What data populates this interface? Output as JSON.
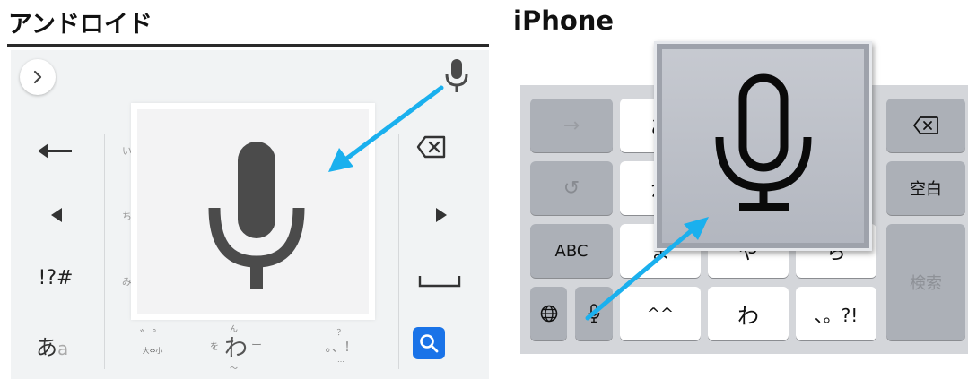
{
  "titles": {
    "android": "アンドロイド",
    "iphone": "iPhone"
  },
  "android": {
    "top_bar": {
      "expand_icon": "chevron-right-icon",
      "mic_icon": "mic-icon"
    },
    "left_keys": [
      {
        "name": "arrow-back-icon",
        "label": "←"
      },
      {
        "name": "cursor-left-icon",
        "label": "◀"
      },
      {
        "label": "!?#"
      },
      {
        "label": "あ",
        "sub": "a"
      }
    ],
    "faint_row_labels": [
      "い",
      "ち",
      "み"
    ],
    "bottom_keys": {
      "dakuten_label": "゛゜",
      "dakuten_sub": "大⇔小",
      "wa_main": "わ",
      "wa_left": "を",
      "wa_top": "ん",
      "wa_right": "ー",
      "wa_bottom": "〜",
      "punct_label": "。、！",
      "punct_top": "？",
      "punct_bottom": "…"
    },
    "right_keys": [
      {
        "name": "backspace-icon",
        "label": "⌫"
      },
      {
        "name": "cursor-right-icon",
        "label": "▶"
      },
      {
        "name": "space-icon",
        "label": "␣"
      },
      {
        "name": "search-icon",
        "label": "🔍"
      }
    ],
    "colors": {
      "search": "#1a73e8",
      "arrow": "#1ab0ee"
    }
  },
  "iphone": {
    "left_keys": [
      {
        "name": "arrow-right-key",
        "label": "→"
      },
      {
        "name": "undo-key",
        "label": "↺"
      },
      {
        "label": "ABC"
      }
    ],
    "center_keys": [
      {
        "label": "あ"
      },
      {
        "label": "か"
      },
      {
        "label": "ま"
      },
      {
        "label": "や"
      },
      {
        "label": "ら"
      },
      {
        "label": "^^"
      },
      {
        "label": "わ"
      },
      {
        "label": "、。?!"
      }
    ],
    "right_keys": [
      {
        "name": "delete-key",
        "label": "⌫"
      },
      {
        "label": "空白"
      },
      {
        "label": "検索"
      }
    ],
    "bottom_icons": {
      "globe": "globe-icon",
      "mic": "mic-icon"
    }
  }
}
